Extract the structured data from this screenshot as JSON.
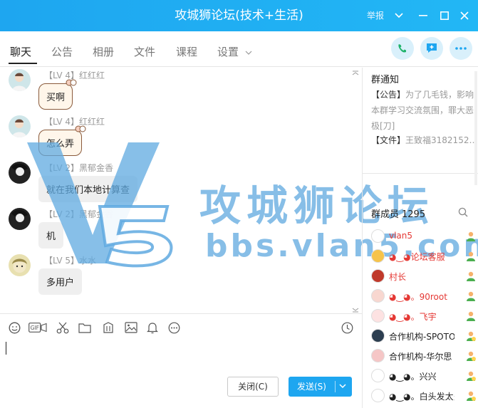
{
  "window": {
    "title": "攻城狮论坛(技术+生活)",
    "report_label": "举报"
  },
  "tabs": [
    {
      "label": "聊天"
    },
    {
      "label": "公告"
    },
    {
      "label": "相册"
    },
    {
      "label": "文件"
    },
    {
      "label": "课程"
    },
    {
      "label": "设置"
    }
  ],
  "messages": [
    {
      "level": "【LV 4】",
      "nick": "红红红",
      "text": "买啊"
    },
    {
      "level": "【LV 4】",
      "nick": "红红红",
      "text": "怎么弄"
    },
    {
      "level": "【LV 2】",
      "nick": "黑郁金香",
      "text": "就在我们本地计算查"
    },
    {
      "level": "【LV 2】",
      "nick": "黑郁金香",
      "text": "机"
    },
    {
      "level": "【LV 5】",
      "nick": "水水",
      "text": "多用户"
    }
  ],
  "watermark": {
    "title": "攻城狮论坛",
    "url": "bbs.vlan5.com"
  },
  "composer": {
    "close_label": "关闭(C)",
    "send_label": "发送(S)"
  },
  "sidebar": {
    "notice_title": "群通知",
    "notice_label": "【公告】",
    "notice_text": "为了几毛钱，影响本群学习交流氛围，罪大恶极[刀]",
    "file_label": "【文件】",
    "file_text": "王致福3182152…",
    "members_title": "群成员",
    "members_count": "1295",
    "members": [
      {
        "name": "vlan5",
        "red": true
      },
      {
        "name": "◕‿◕论坛客服",
        "red": true
      },
      {
        "name": "村长",
        "red": true
      },
      {
        "name": "◕‿◕。90root",
        "red": true
      },
      {
        "name": "◕‿◕。飞宇",
        "red": true
      },
      {
        "name": "合作机构-SPOTO",
        "red": false
      },
      {
        "name": "合作机构-华尔思",
        "red": false
      },
      {
        "name": "◕‿◕。兴兴",
        "red": false
      },
      {
        "name": "◕‿◕。白头发太多",
        "red": false
      }
    ]
  },
  "colors": {
    "accent": "#1ea6f0",
    "watermark": "#5fa9e0",
    "red_name": "#e53935"
  },
  "icons": [
    "phone-icon",
    "add-chat-icon",
    "more-icon",
    "emoji-icon",
    "gif-icon",
    "scissors-icon",
    "folder-icon",
    "gift-icon",
    "image-icon",
    "bell-icon",
    "more-tools-icon",
    "history-icon",
    "search-icon"
  ]
}
